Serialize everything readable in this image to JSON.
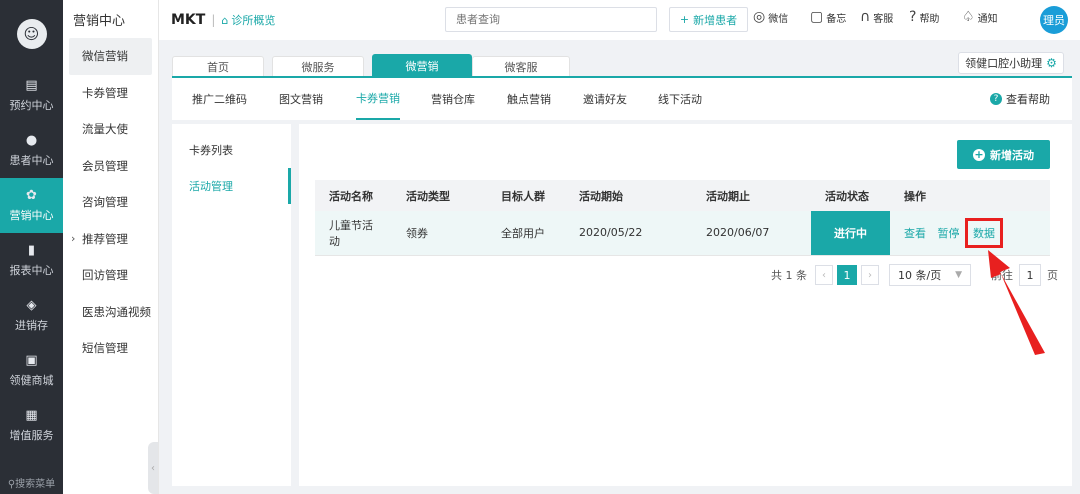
{
  "rail": {
    "items": [
      {
        "label": "预约中心",
        "icon": "calendar-icon",
        "glyph": "▤"
      },
      {
        "label": "患者中心",
        "icon": "patient-icon",
        "glyph": "●"
      },
      {
        "label": "营销中心",
        "icon": "marketing-icon",
        "glyph": "✿"
      },
      {
        "label": "报表中心",
        "icon": "chart-icon",
        "glyph": "▮"
      },
      {
        "label": "进销存",
        "icon": "layers-icon",
        "glyph": "◈"
      },
      {
        "label": "领健商城",
        "icon": "shop-icon",
        "glyph": "▣"
      },
      {
        "label": "增值服务",
        "icon": "grid-icon",
        "glyph": "▦"
      }
    ],
    "search_placeholder": "搜索菜单"
  },
  "submenu": {
    "title": "营销中心",
    "items": [
      "微信营销",
      "卡券管理",
      "流量大使",
      "会员管理",
      "咨询管理",
      "推荐管理",
      "回访管理",
      "医患沟通视频",
      "短信管理"
    ]
  },
  "topbar": {
    "brand": "MKT",
    "clinic_label": "诊所概览",
    "search_placeholder": "患者查询",
    "new_patient": "新增患者",
    "wechat": "微信",
    "memo": "备忘",
    "service": "客服",
    "help": "帮助",
    "notify": "通知",
    "avatar": "理员"
  },
  "tabs": [
    "首页",
    "微服务",
    "微营销",
    "微客服"
  ],
  "assistant": "领健口腔小助理",
  "subnav": {
    "items": [
      "推广二维码",
      "图文营销",
      "卡券营销",
      "营销仓库",
      "触点营销",
      "邀请好友",
      "线下活动"
    ],
    "help": "查看帮助"
  },
  "inner_menu": [
    "卡券列表",
    "活动管理"
  ],
  "main": {
    "add_button": "新增活动",
    "columns": [
      "活动名称",
      "活动类型",
      "目标人群",
      "活动期始",
      "活动期止",
      "活动状态",
      "操作"
    ],
    "rows": [
      {
        "name_line1": "儿童节活",
        "name_line2": "动",
        "type": "领券",
        "target": "全部用户",
        "start": "2020/05/22",
        "end": "2020/06/07",
        "status": "进行中",
        "op_view": "查看",
        "op_pause": "暂停",
        "op_data": "数据"
      }
    ]
  },
  "pager": {
    "total": "共 1 条",
    "current": "1",
    "page_size": "10 条/页",
    "jump_prefix": "前往",
    "jump_value": "1",
    "jump_suffix": "页"
  },
  "colors": {
    "accent": "#1aa8a8",
    "highlight": "#e8201f",
    "rail": "#2b2f36"
  }
}
